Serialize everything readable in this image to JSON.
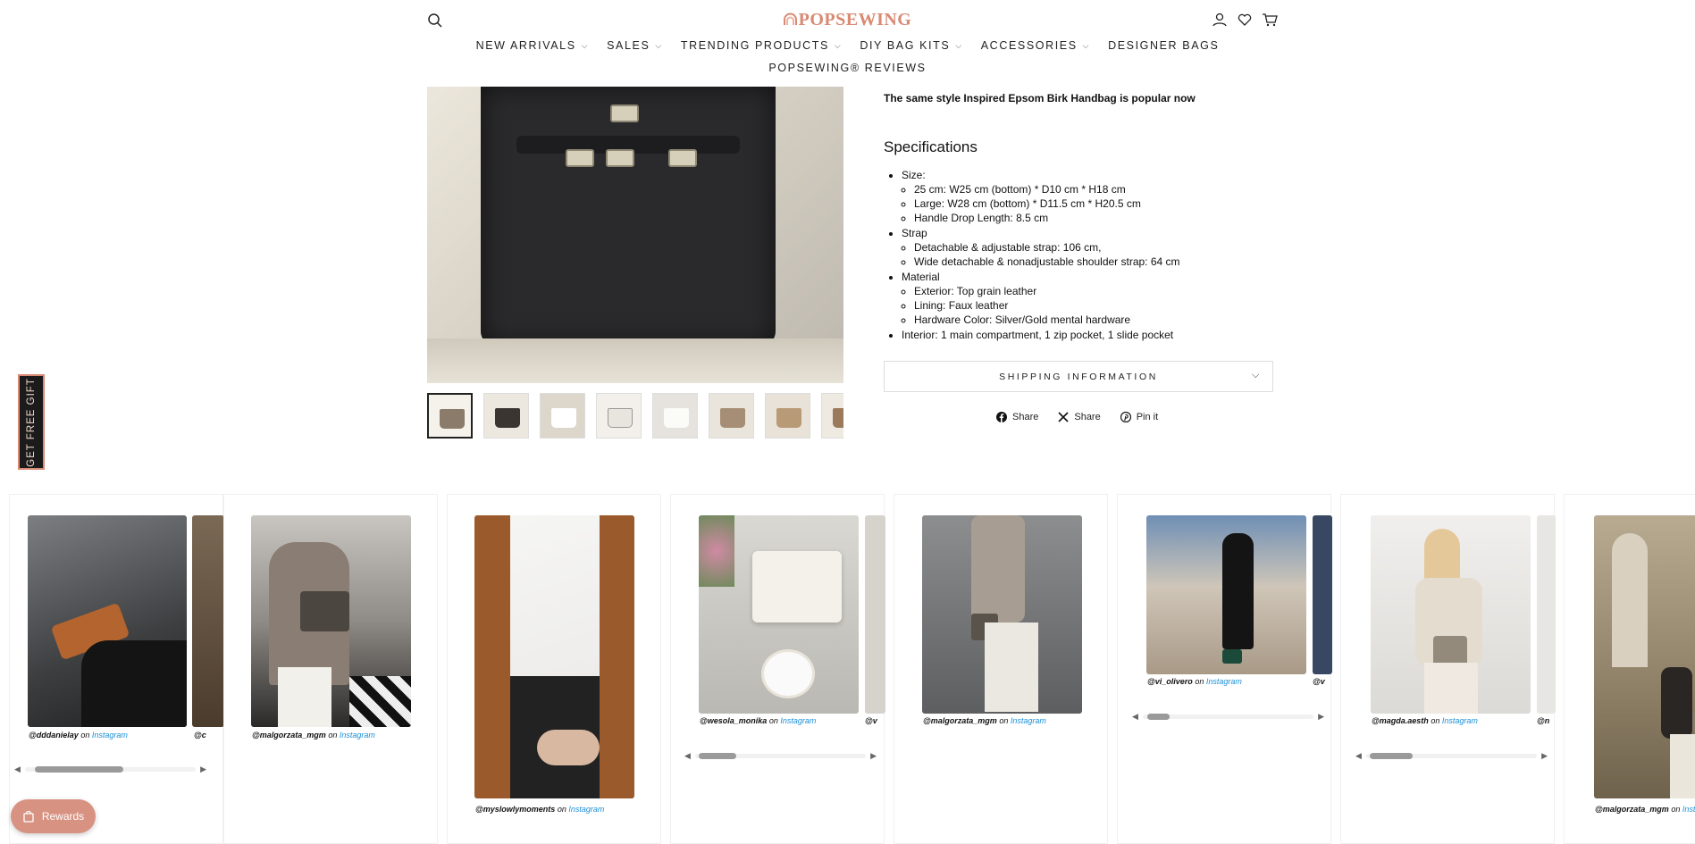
{
  "header": {
    "logo_text": "POPSEWING",
    "icons": [
      "search-icon",
      "account-icon",
      "wishlist-icon",
      "cart-icon"
    ],
    "nav": [
      {
        "label": "NEW ARRIVALS",
        "has_dropdown": true
      },
      {
        "label": "SALES",
        "has_dropdown": true
      },
      {
        "label": "TRENDING PRODUCTS",
        "has_dropdown": true
      },
      {
        "label": "DIY BAG KITS",
        "has_dropdown": true
      },
      {
        "label": "ACCESSORIES",
        "has_dropdown": true
      },
      {
        "label": "DESIGNER BAGS",
        "has_dropdown": false
      }
    ],
    "nav_second_row": "POPSEWING® REVIEWS"
  },
  "product": {
    "tagline": "The same style Inspired Epsom Birk Handbag is popular now",
    "specs_title": "Specifications",
    "specs": {
      "size_label": "Size:",
      "size_items": [
        "25 cm: W25 cm (bottom) * D10 cm * H18 cm",
        "Large: W28 cm (bottom) * D11.5 cm * H20.5 cm",
        "Handle Drop Length: 8.5 cm"
      ],
      "strap_label": "Strap",
      "strap_items": [
        "Detachable & adjustable strap: 106 cm,",
        "Wide detachable & nonadjustable shoulder strap: 64 cm"
      ],
      "material_label": "Material",
      "material_items": [
        "Exterior: Top grain leather",
        "Lining: Faux leather",
        "Hardware Color: Silver/Gold mental hardware"
      ],
      "interior": "Interior: 1 main compartment, 1 zip pocket, 1 slide pocket"
    },
    "shipping_label": "SHIPPING INFORMATION",
    "share": {
      "facebook": "Share",
      "x": "Share",
      "pinterest": "Pin it"
    }
  },
  "gift_tab": "GET FREE GIFT",
  "ugc": [
    {
      "handle": "@dddanielay",
      "peek": "@c"
    },
    {
      "handle": "@malgorzata_mgm",
      "peek": ""
    },
    {
      "handle": "@myslowlymoments",
      "peek": ""
    },
    {
      "handle": "@wesola_monika",
      "peek": "@v"
    },
    {
      "handle": "@malgorzata_mgm",
      "peek": ""
    },
    {
      "handle": "@vi_olivero",
      "peek": "@v"
    },
    {
      "handle": "@magda.aesth",
      "peek": "@n"
    },
    {
      "handle": "@malgorzata_mgm",
      "peek": ""
    }
  ],
  "ugc_on": "on",
  "ugc_source": "Instagram",
  "rewards_label": "Rewards",
  "colors": {
    "brand": "#d88a73",
    "link": "#1b8fd6",
    "rewards_bg": "#d89282"
  }
}
